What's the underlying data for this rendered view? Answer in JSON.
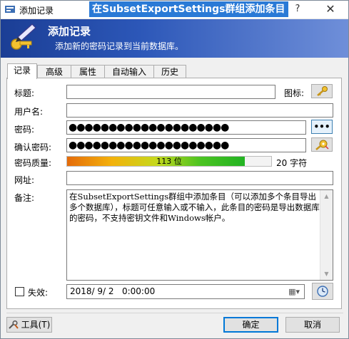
{
  "window": {
    "title": "添加记录",
    "overlay_title": "在SubsetExportSettings群组添加条目",
    "help_glyph": "?",
    "close_glyph": "✕"
  },
  "banner": {
    "title": "添加记录",
    "subtitle": "添加新的密码记录到当前数据库。",
    "icon": "key-pen-icon"
  },
  "tabs": [
    {
      "label": "记录",
      "active": true
    },
    {
      "label": "高级",
      "active": false
    },
    {
      "label": "属性",
      "active": false
    },
    {
      "label": "自动输入",
      "active": false
    },
    {
      "label": "历史",
      "active": false
    }
  ],
  "form": {
    "title_label": "标题:",
    "title_value": "",
    "icon_label": "图标:",
    "username_label": "用户名:",
    "username_value": "",
    "password_label": "密码:",
    "password_value": "●●●●●●●●●●●●●●●●●●●●",
    "reveal_button_label": "•••",
    "confirm_label": "确认密码:",
    "confirm_value": "●●●●●●●●●●●●●●●●●●●●",
    "quality_label": "密码质量:",
    "quality_text": "113 位",
    "quality_fraction": 0.87,
    "length_text": "20 字符",
    "url_label": "网址:",
    "url_value": "",
    "notes_label": "备注:",
    "notes_value": "在SubsetExportSettings群组中添加条目（可以添加多个条目导出多个数据库），标题可任意输入或不输入，此条目的密码是导出数据库的密码，不支持密钥文件和Windows帐户。",
    "expires_label": "失效:",
    "expires_checked": false,
    "expires_value": "2018/ 9/ 2   0:00:00"
  },
  "footer": {
    "tools_label": "工具(T)",
    "ok_label": "确定",
    "cancel_label": "取消"
  },
  "colors": {
    "banner_start": "#1b3e95",
    "banner_end": "#6f8fd9",
    "overlay_bg": "#2a7ad6"
  }
}
